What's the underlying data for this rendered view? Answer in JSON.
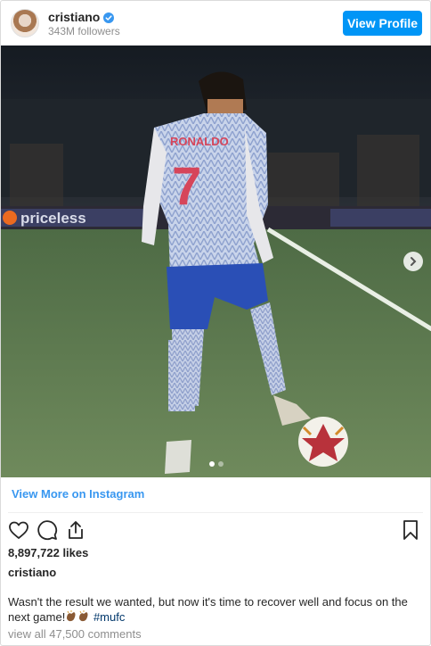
{
  "header": {
    "username": "cristiano",
    "followers": "343M followers",
    "view_profile_label": "View Profile"
  },
  "media": {
    "jersey_name": "RONALDO",
    "jersey_number": "7",
    "billboard_text": "priceless",
    "carousel_total": 2,
    "carousel_active": 1
  },
  "links": {
    "view_more": "View More on Instagram"
  },
  "post": {
    "likes": "8,897,722 likes",
    "caption_username": "cristiano",
    "caption_text": "Wasn't the result we wanted, but now it's time to recover well and focus on the next game!",
    "hashtag": "#mufc",
    "comments_link": "view all 47,500 comments"
  },
  "icons": [
    "verified-badge-icon",
    "chevron-right-icon",
    "heart-icon",
    "comment-icon",
    "share-icon",
    "bookmark-icon",
    "clapping-hands-emoji-icon"
  ],
  "colors": {
    "accent": "#0095f6",
    "link": "#3897f0",
    "hashtag": "#00376b",
    "muted": "#8e8e8e"
  }
}
